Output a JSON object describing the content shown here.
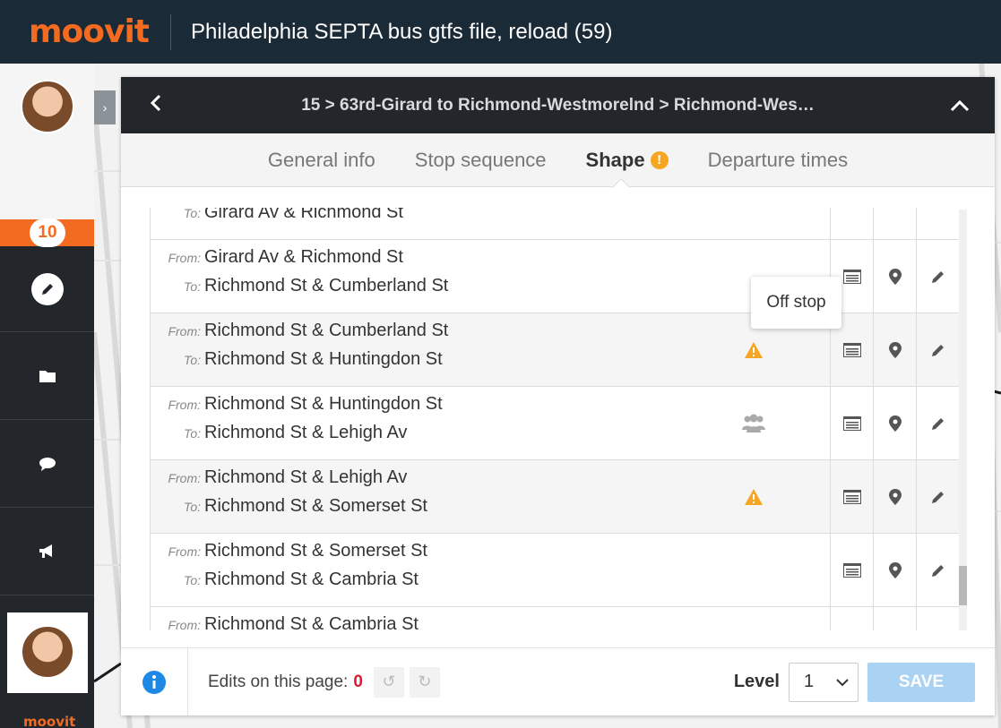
{
  "app": {
    "logo": "moovit",
    "title": "Philadelphia SEPTA bus gtfs file, reload (59)"
  },
  "sidebar": {
    "badge": "10",
    "footer_logo": "moovit"
  },
  "panel": {
    "breadcrumb": "15 > 63rd-Girard to Richmond-Westmorelnd > Richmond-Wes…",
    "tabs": [
      {
        "label": "General info"
      },
      {
        "label": "Stop sequence"
      },
      {
        "label": "Shape",
        "warning": "!"
      },
      {
        "label": "Departure times"
      }
    ]
  },
  "segments": {
    "from_label": "From:",
    "to_label": "To:",
    "partial_top": {
      "to": "Girard Av & Richmond St"
    },
    "rows": [
      {
        "from": "Girard Av & Richmond St",
        "to": "Richmond St & Cumberland St",
        "status": "none"
      },
      {
        "from": "Richmond St & Cumberland St",
        "to": "Richmond St & Huntingdon St",
        "status": "warning"
      },
      {
        "from": "Richmond St & Huntingdon St",
        "to": "Richmond St & Lehigh Av",
        "status": "people"
      },
      {
        "from": "Richmond St & Lehigh Av",
        "to": "Richmond St & Somerset St",
        "status": "warning"
      },
      {
        "from": "Richmond St & Somerset St",
        "to": "Richmond St & Cambria St",
        "status": "none"
      }
    ],
    "partial_bottom": {
      "from": "Richmond St & Cambria St"
    }
  },
  "tooltip": "Off stop",
  "footer": {
    "edits_label": "Edits on this page:",
    "edits_count": "0",
    "level_label": "Level",
    "level_value": "1",
    "save_label": "SAVE"
  },
  "colors": {
    "brand": "#f26b21",
    "warning": "#f5a623",
    "header": "#23272b",
    "save_disabled": "#a9d2f3"
  }
}
